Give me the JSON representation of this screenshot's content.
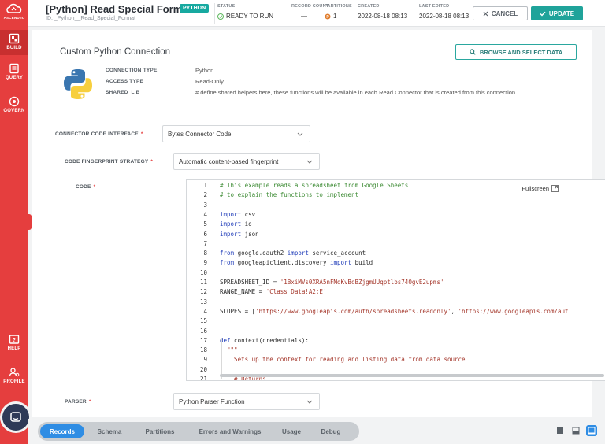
{
  "sidebar": {
    "logo_text": "ASCEND.IO",
    "items": [
      {
        "label": "BUILD",
        "icon": "build-icon"
      },
      {
        "label": "QUERY",
        "icon": "query-icon"
      },
      {
        "label": "GOVERN",
        "icon": "govern-icon"
      },
      {
        "label": "HELP",
        "icon": "help-icon"
      },
      {
        "label": "PROFILE",
        "icon": "profile-icon"
      }
    ]
  },
  "header": {
    "title": "[Python] Read Special Format",
    "badge": "PYTHON",
    "subtitle": "ID: _Python__Read_Special_Format",
    "status_label": "STATUS",
    "status_value": "READY TO RUN",
    "record_count_label": "RECORD COUNT",
    "record_count_value": "—",
    "partitions_label": "PARTITIONS",
    "partitions_value": "1",
    "created_label": "CREATED",
    "created_value": "2022-08-18 08:13",
    "last_edited_label": "LAST EDITED",
    "last_edited_value": "2022-08-18 08:13",
    "cancel_label": "CANCEL",
    "update_label": "UPDATE"
  },
  "connection": {
    "title": "Custom Python Connection",
    "browse_label": "BROWSE AND SELECT DATA",
    "fields": [
      {
        "key": "CONNECTION TYPE",
        "value": "Python"
      },
      {
        "key": "ACCESS TYPE",
        "value": "Read-Only"
      },
      {
        "key": "SHARED_LIB",
        "value": "# define shared helpers here, these functions will be available in each Read Connector that is created from this connection"
      }
    ]
  },
  "form": {
    "interface_label": "CONNECTOR CODE INTERFACE",
    "interface_value": "Bytes Connector Code",
    "fingerprint_label": "CODE FINGERPRINT STRATEGY",
    "fingerprint_value": "Automatic content-based fingerprint",
    "code_label": "CODE",
    "fullscreen_label": "Fullscreen",
    "parser_label": "PARSER",
    "parser_value": "Python Parser Function",
    "required_mark": "*"
  },
  "code": {
    "lines": [
      {
        "n": "1",
        "parts": [
          {
            "t": "# This example reads a spreadsheet from Google Sheets",
            "c": "comment"
          }
        ]
      },
      {
        "n": "2",
        "parts": [
          {
            "t": "# to explain the functions to implement",
            "c": "comment"
          }
        ]
      },
      {
        "n": "3",
        "parts": []
      },
      {
        "n": "4",
        "parts": [
          {
            "t": "import",
            "c": "kw"
          },
          {
            "t": " csv",
            "c": ""
          }
        ]
      },
      {
        "n": "5",
        "parts": [
          {
            "t": "import",
            "c": "kw"
          },
          {
            "t": " io",
            "c": ""
          }
        ]
      },
      {
        "n": "6",
        "parts": [
          {
            "t": "import",
            "c": "kw"
          },
          {
            "t": " json",
            "c": ""
          }
        ]
      },
      {
        "n": "7",
        "parts": []
      },
      {
        "n": "8",
        "parts": [
          {
            "t": "from",
            "c": "kw"
          },
          {
            "t": " google.oauth2 ",
            "c": ""
          },
          {
            "t": "import",
            "c": "kw"
          },
          {
            "t": " service_account",
            "c": ""
          }
        ]
      },
      {
        "n": "9",
        "parts": [
          {
            "t": "from",
            "c": "kw"
          },
          {
            "t": " googleapiclient.discovery ",
            "c": ""
          },
          {
            "t": "import",
            "c": "kw"
          },
          {
            "t": " build",
            "c": ""
          }
        ]
      },
      {
        "n": "10",
        "parts": []
      },
      {
        "n": "11",
        "parts": [
          {
            "t": "SPREADSHEET_ID = ",
            "c": ""
          },
          {
            "t": "'1BxiMVs0XRA5nFMdKvBdBZjgmUUqptlbs74OgvE2upms'",
            "c": "str"
          }
        ]
      },
      {
        "n": "12",
        "parts": [
          {
            "t": "RANGE_NAME = ",
            "c": ""
          },
          {
            "t": "'Class Data!A2:E'",
            "c": "str"
          }
        ]
      },
      {
        "n": "13",
        "parts": []
      },
      {
        "n": "14",
        "parts": [
          {
            "t": "SCOPES = [",
            "c": ""
          },
          {
            "t": "'https://www.googleapis.com/auth/spreadsheets.readonly'",
            "c": "str"
          },
          {
            "t": ", ",
            "c": ""
          },
          {
            "t": "'https://www.googleapis.com/aut",
            "c": "str"
          }
        ]
      },
      {
        "n": "15",
        "parts": []
      },
      {
        "n": "16",
        "parts": []
      },
      {
        "n": "17",
        "parts": [
          {
            "t": "def",
            "c": "kw"
          },
          {
            "t": " context(credentials):",
            "c": ""
          }
        ]
      },
      {
        "n": "18",
        "parts": [
          {
            "t": "  \"\"\"",
            "c": "str"
          }
        ]
      },
      {
        "n": "19",
        "parts": [
          {
            "t": "    Sets up the context for reading and listing data from data source",
            "c": "str"
          }
        ]
      },
      {
        "n": "20",
        "parts": []
      },
      {
        "n": "21",
        "parts": [
          {
            "t": "    # Returns",
            "c": "str"
          }
        ]
      }
    ]
  },
  "bottom_tabs": [
    "Records",
    "Schema",
    "Partitions",
    "Errors and Warnings",
    "Usage",
    "Debug"
  ],
  "colors": {
    "brand_red": "#e53e3e",
    "accent_teal": "#1fa39a",
    "active_blue": "#2f8de4",
    "ready_green": "#5fb85f",
    "partition_orange": "#e07b2a"
  }
}
